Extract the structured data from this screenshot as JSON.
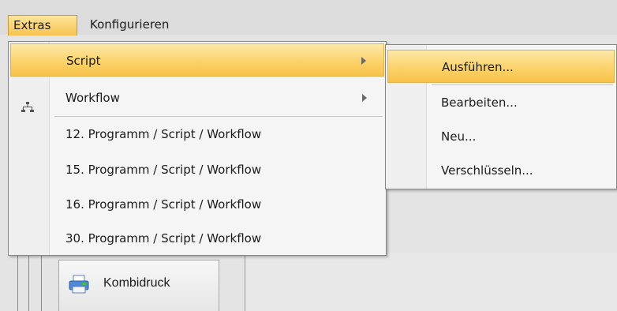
{
  "menubar": {
    "items": [
      "Extras",
      "Konfigurieren"
    ]
  },
  "extras_menu": {
    "script_label": "Script",
    "workflow_label": "Workflow",
    "recent": [
      "12. Programm / Script / Workflow",
      "15. Programm / Script / Workflow",
      "16. Programm / Script / Workflow",
      "30. Programm / Script / Workflow"
    ]
  },
  "script_submenu": {
    "items": [
      "Ausführen...",
      "Bearbeiten...",
      "Neu...",
      "Verschlüsseln..."
    ]
  },
  "background": {
    "kombidruck_label": "Kombidruck"
  },
  "colors": {
    "highlight": "#fbd36a",
    "highlight_border": "#e0b24c"
  }
}
